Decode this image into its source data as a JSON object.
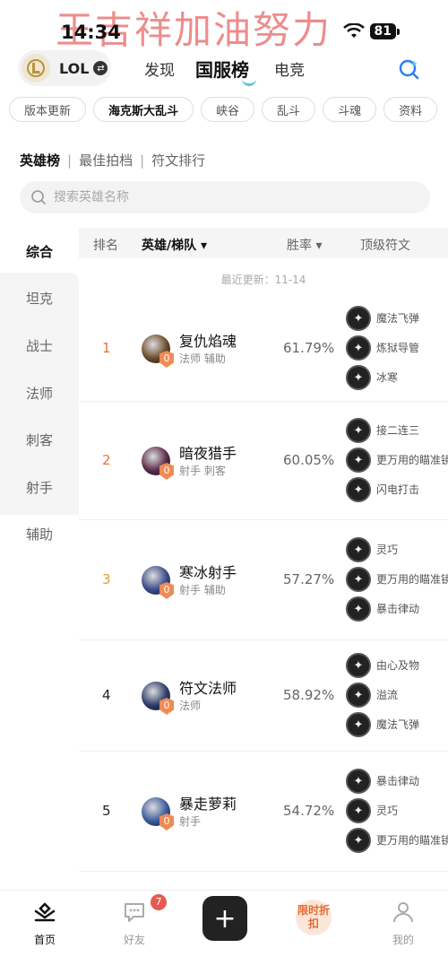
{
  "status": {
    "time": "14:34",
    "battery": "81",
    "banner": "王吉祥加油努力"
  },
  "topnav": {
    "game": "LOL",
    "tabs": [
      "发现",
      "国服榜",
      "电竞"
    ]
  },
  "chips": [
    "版本更新",
    "海克斯大乱斗",
    "峡谷",
    "乱斗",
    "斗魂",
    "资料"
  ],
  "subtabs": [
    "英雄榜",
    "最佳拍档",
    "符文排行"
  ],
  "search": {
    "placeholder": "搜索英雄名称"
  },
  "categories": [
    "综合",
    "坦克",
    "战士",
    "法师",
    "刺客",
    "射手",
    "辅助"
  ],
  "table": {
    "headers": {
      "rank": "排名",
      "hero": "英雄/梯队 ▾",
      "winrate": "胜率 ▾",
      "runes": "顶级符文"
    },
    "updated": "最近更新：11-14",
    "rows": [
      {
        "rank": "1",
        "rank_color": "#e8743a",
        "name": "复仇焰魂",
        "roles": "法师 辅助",
        "tier": "0",
        "winrate": "61.79%",
        "avatar_color": "#6a4a2a",
        "runes": [
          {
            "name": "魔法飞弹",
            "icon": "missile-rune-icon"
          },
          {
            "name": "炼狱导管",
            "icon": "conduit-rune-icon"
          },
          {
            "name": "冰寒",
            "icon": "frost-rune-icon"
          }
        ]
      },
      {
        "rank": "2",
        "rank_color": "#e8743a",
        "name": "暗夜猎手",
        "roles": "射手 刺客",
        "tier": "0",
        "winrate": "60.05%",
        "avatar_color": "#5a2a4a",
        "runes": [
          {
            "name": "接二连三",
            "icon": "combo-rune-icon"
          },
          {
            "name": "更万用的瞄准镜",
            "icon": "scope-rune-icon"
          },
          {
            "name": "闪电打击",
            "icon": "lightning-rune-icon"
          }
        ]
      },
      {
        "rank": "3",
        "rank_color": "#e0a030",
        "name": "寒冰射手",
        "roles": "射手 辅助",
        "tier": "0",
        "winrate": "57.27%",
        "avatar_color": "#3a4a8a",
        "runes": [
          {
            "name": "灵巧",
            "icon": "agility-rune-icon"
          },
          {
            "name": "更万用的瞄准镜",
            "icon": "scope-rune-icon"
          },
          {
            "name": "暴击律动",
            "icon": "crit-rune-icon"
          }
        ]
      },
      {
        "rank": "4",
        "rank_color": "#222222",
        "name": "符文法师",
        "roles": "法师",
        "tier": "0",
        "winrate": "58.92%",
        "avatar_color": "#2a3a6a",
        "runes": [
          {
            "name": "由心及物",
            "icon": "shield-rune-icon"
          },
          {
            "name": "溢流",
            "icon": "overflow-rune-icon"
          },
          {
            "name": "魔法飞弹",
            "icon": "missile-rune-icon"
          }
        ]
      },
      {
        "rank": "5",
        "rank_color": "#222222",
        "name": "暴走萝莉",
        "roles": "射手",
        "tier": "0",
        "winrate": "54.72%",
        "avatar_color": "#3a5a9a",
        "runes": [
          {
            "name": "暴击律动",
            "icon": "crit-rune-icon"
          },
          {
            "name": "灵巧",
            "icon": "agility-rune-icon"
          },
          {
            "name": "更万用的瞄准镜",
            "icon": "scope-rune-icon"
          }
        ]
      }
    ]
  },
  "tabbar": {
    "home": "首页",
    "friends": "好友",
    "friends_badge": "7",
    "promo": "限时折扣",
    "me": "我的"
  }
}
